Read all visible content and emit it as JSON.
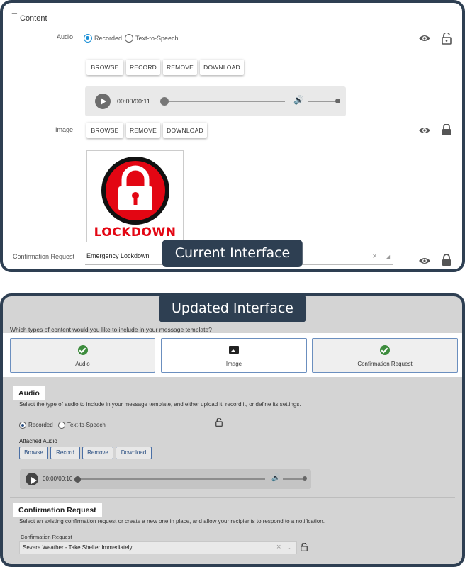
{
  "current": {
    "panel_label": "Current Interface",
    "section_title": "Content",
    "audio": {
      "label": "Audio",
      "options": [
        "Recorded",
        "Text-to-Speech"
      ],
      "selected": "Recorded",
      "buttons": [
        "BROWSE",
        "RECORD",
        "REMOVE",
        "DOWNLOAD"
      ],
      "player_time": "00:00/00:11"
    },
    "image": {
      "label": "Image",
      "buttons": [
        "BROWSE",
        "REMOVE",
        "DOWNLOAD"
      ],
      "thumbnail_text": "LOCKDOWN"
    },
    "confirmation": {
      "label": "Confirmation Request",
      "value": "Emergency Lockdown",
      "clear_glyph": "×"
    }
  },
  "updated": {
    "panel_label": "Updated Interface",
    "question": "Which types of content would you like to include in your message template?",
    "content_types": [
      {
        "label": "Audio",
        "icon": "check-circle-icon",
        "selected": true
      },
      {
        "label": "Image",
        "icon": "image-icon",
        "selected": false
      },
      {
        "label": "Confirmation Request",
        "icon": "check-circle-icon",
        "selected": true
      }
    ],
    "audio": {
      "header": "Audio",
      "description": "Select the type of audio to include in your message template, and either upload it, record it, or define its settings.",
      "options": [
        "Recorded",
        "Text-to-Speech"
      ],
      "selected": "Recorded",
      "attached_label": "Attached Audio",
      "buttons": [
        "Browse",
        "Record",
        "Remove",
        "Download"
      ],
      "player_time": "00:00/00:10"
    },
    "confirmation": {
      "header": "Confirmation Request",
      "description": "Select an existing confirmation request or create a new one in place, and allow your recipients to respond to a notification.",
      "field_label": "Confirmation Request",
      "value": "Severe Weather - Take Shelter Immediately",
      "clear_glyph": "×"
    }
  },
  "colors": {
    "frame": "#2e3f52",
    "radio_selected": "#1a8fd6",
    "check_green": "#3d8c3d",
    "outline_blue": "#4a6fa5",
    "lockdown_red": "#e30613"
  }
}
